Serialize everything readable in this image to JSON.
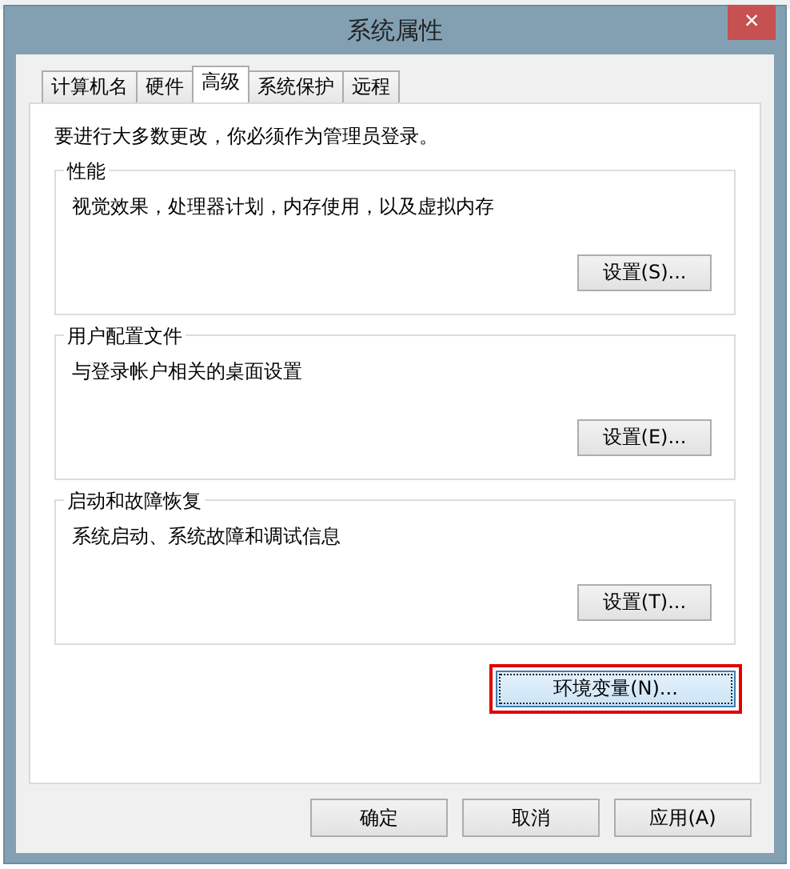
{
  "window": {
    "title": "系统属性",
    "close": "×"
  },
  "tabs": [
    {
      "label": "计算机名",
      "selected": false
    },
    {
      "label": "硬件",
      "selected": false
    },
    {
      "label": "高级",
      "selected": true
    },
    {
      "label": "系统保护",
      "selected": false
    },
    {
      "label": "远程",
      "selected": false
    }
  ],
  "notice": "要进行大多数更改，你必须作为管理员登录。",
  "groups": [
    {
      "title": "性能",
      "description": "视觉效果，处理器计划，内存使用，以及虚拟内存",
      "button": "设置(S)..."
    },
    {
      "title": "用户配置文件",
      "description": "与登录帐户相关的桌面设置",
      "button": "设置(E)..."
    },
    {
      "title": "启动和故障恢复",
      "description": "系统启动、系统故障和调试信息",
      "button": "设置(T)..."
    }
  ],
  "env_button": {
    "label": "环境变量(N)...",
    "highlighted": true
  },
  "buttons": [
    "确定",
    "取消",
    "应用(A)"
  ]
}
